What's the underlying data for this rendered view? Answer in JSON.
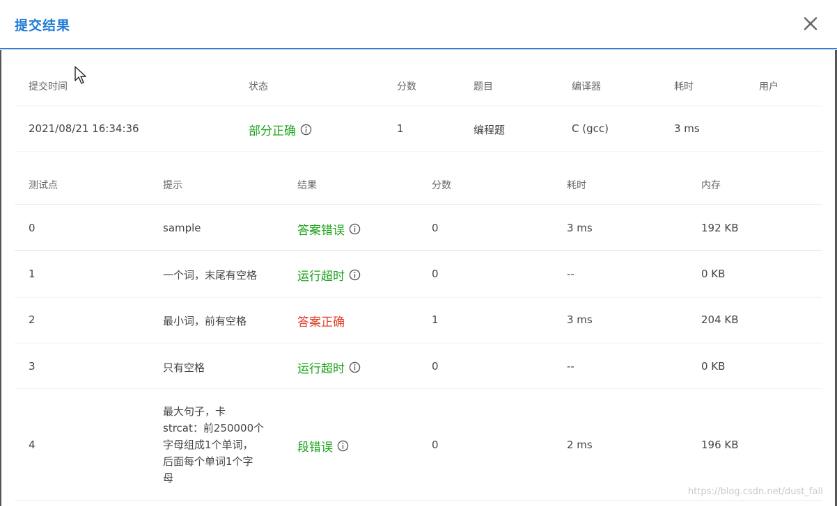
{
  "dialog": {
    "title": "提交结果",
    "close_icon": "close-icon"
  },
  "summary": {
    "headers": {
      "time": "提交时间",
      "status": "状态",
      "score": "分数",
      "problem": "题目",
      "compiler": "编译器",
      "elapsed": "耗时",
      "user": "用户"
    },
    "row": {
      "time": "2021/08/21 16:34:36",
      "status": "部分正确",
      "score": "1",
      "problem": "编程题",
      "compiler": "C (gcc)",
      "elapsed": "3 ms",
      "user": ""
    }
  },
  "tests": {
    "headers": {
      "point": "测试点",
      "hint": "提示",
      "result": "结果",
      "score": "分数",
      "elapsed": "耗时",
      "memory": "内存"
    },
    "rows": [
      {
        "point": "0",
        "hint": "sample",
        "result": "答案错误",
        "result_color": "#1aa31a",
        "has_info": true,
        "score": "0",
        "elapsed": "3 ms",
        "memory": "192 KB"
      },
      {
        "point": "1",
        "hint": "一个词，末尾有空格",
        "result": "运行超时",
        "result_color": "#1aa31a",
        "has_info": true,
        "score": "0",
        "elapsed": "--",
        "memory": "0 KB"
      },
      {
        "point": "2",
        "hint": "最小词，前有空格",
        "result": "答案正确",
        "result_color": "#e0442c",
        "has_info": false,
        "score": "1",
        "elapsed": "3 ms",
        "memory": "204 KB"
      },
      {
        "point": "3",
        "hint": "只有空格",
        "result": "运行超时",
        "result_color": "#1aa31a",
        "has_info": true,
        "score": "0",
        "elapsed": "--",
        "memory": "0 KB"
      },
      {
        "point": "4",
        "hint_lines": [
          "最大句子，卡",
          "strcat：前250000个",
          "字母组成1个单词，",
          "后面每个单词1个字",
          "母"
        ],
        "result": "段错误",
        "result_color": "#1aa31a",
        "has_info": true,
        "score": "0",
        "elapsed": "2 ms",
        "memory": "196 KB"
      }
    ]
  },
  "watermark": "https://blog.csdn.net/dust_fall"
}
